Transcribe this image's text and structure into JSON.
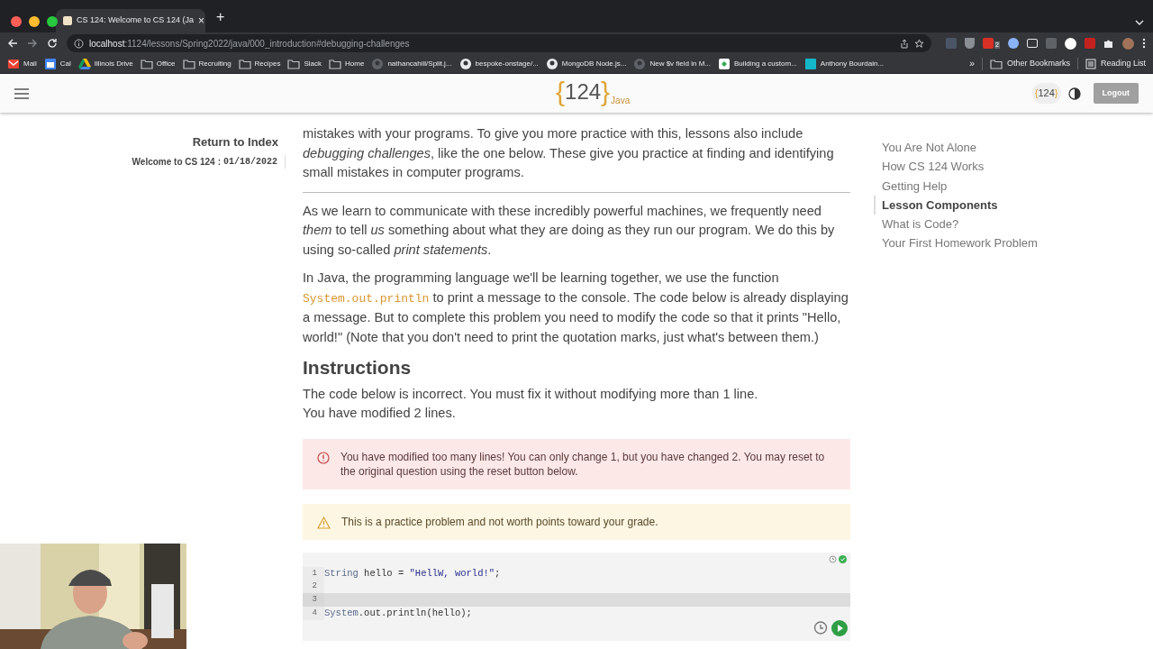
{
  "browser": {
    "tab_title": "CS 124: Welcome to CS 124 (Ja",
    "tab_close": "×",
    "new_tab": "+",
    "url_host": "localhost",
    "url_path": ":1124/lessons/Spring2022/java/000_introduction#debugging-challenges",
    "extension_badge": "2",
    "bookmarks": [
      {
        "label": "Mail",
        "kind": "mail"
      },
      {
        "label": "Cal",
        "kind": "cal"
      },
      {
        "label": "Illinois Drive",
        "kind": "drive"
      },
      {
        "label": "Office",
        "kind": "folder"
      },
      {
        "label": "Recruiting",
        "kind": "folder"
      },
      {
        "label": "Recipes",
        "kind": "folder"
      },
      {
        "label": "Slack",
        "kind": "folder"
      },
      {
        "label": "Home",
        "kind": "folder"
      },
      {
        "label": "nathancahill/Split.j...",
        "kind": "github-dark"
      },
      {
        "label": "bespoke-onstage/...",
        "kind": "github"
      },
      {
        "label": "MongoDB Node.js...",
        "kind": "github"
      },
      {
        "label": "New $v field in M...",
        "kind": "github-dark"
      },
      {
        "label": "Building a custom...",
        "kind": "app"
      },
      {
        "label": "Anthony Bourdain...",
        "kind": "teal"
      }
    ],
    "more": "»",
    "other_bookmarks": "Other Bookmarks",
    "reading_list": "Reading List"
  },
  "header": {
    "brace_open": "{",
    "logo": "124",
    "brace_close": "}",
    "logo_sub": "Java",
    "badge": "124",
    "logout": "Logout"
  },
  "sidebar": {
    "return": "Return to Index",
    "lesson": "Welcome to CS 124",
    "separator": ":",
    "date": "01/18/2022"
  },
  "content": {
    "paragraphs": [
      {
        "segments": [
          {
            "kind": "text",
            "text": "mistakes with your programs. To give you more practice with this, lessons also include *debugging challenges*, like the one below. These give you practice at finding and identifying small mistakes in computer programs."
          }
        ]
      },
      {
        "segments": [
          {
            "kind": "text",
            "text": "As we learn to communicate with these incredibly powerful machines, we frequently need *them* to tell *us* something about what they are doing as they run our program. We do this by using so-called *print statements*."
          }
        ]
      },
      {
        "segments": [
          {
            "kind": "text",
            "text": "In Java, the programming language we'll be learning together, we use the function "
          },
          {
            "kind": "code",
            "text": "System.out.println"
          },
          {
            "kind": "text",
            "text": " to print a message to the console. The code below is already displaying a message. But to complete this problem you need to modify the code so that it prints \"Hello, world!\" (Note that you don't need to print the quotation marks, just what's between them.)"
          }
        ]
      }
    ],
    "heading": "Instructions",
    "instructions": [
      "The code below is incorrect. You must fix it without modifying more than 1 line.",
      "You have modified 2 lines."
    ],
    "alerts": [
      {
        "kind": "error",
        "text": "You have modified too many lines! You can only change 1, but you have changed 2. You may reset to the original question using the reset button below."
      },
      {
        "kind": "warning",
        "text": "This is a practice problem and not worth points toward your grade."
      }
    ],
    "editor": {
      "lines": [
        {
          "number": "1",
          "highlighted": false,
          "tokens": [
            {
              "kind": "type",
              "text": "String"
            },
            {
              "kind": "plain",
              "text": " hello = "
            },
            {
              "kind": "string",
              "text": "\"HellW, world!\""
            },
            {
              "kind": "plain",
              "text": ";"
            }
          ]
        },
        {
          "number": "2",
          "highlighted": false
        },
        {
          "number": "3",
          "highlighted": true
        },
        {
          "number": "4",
          "highlighted": false,
          "tokens": [
            {
              "kind": "type",
              "text": "System"
            },
            {
              "kind": "plain",
              "text": ".out.println(hello);"
            }
          ]
        }
      ]
    }
  },
  "toc": [
    {
      "label": "You Are Not Alone",
      "selected": false
    },
    {
      "label": "How CS 124 Works",
      "selected": false
    },
    {
      "label": "Getting Help",
      "selected": false
    },
    {
      "label": "Lesson Components",
      "selected": true
    },
    {
      "label": "What is Code?",
      "selected": false
    },
    {
      "label": "Your First Homework Problem",
      "selected": false
    }
  ]
}
